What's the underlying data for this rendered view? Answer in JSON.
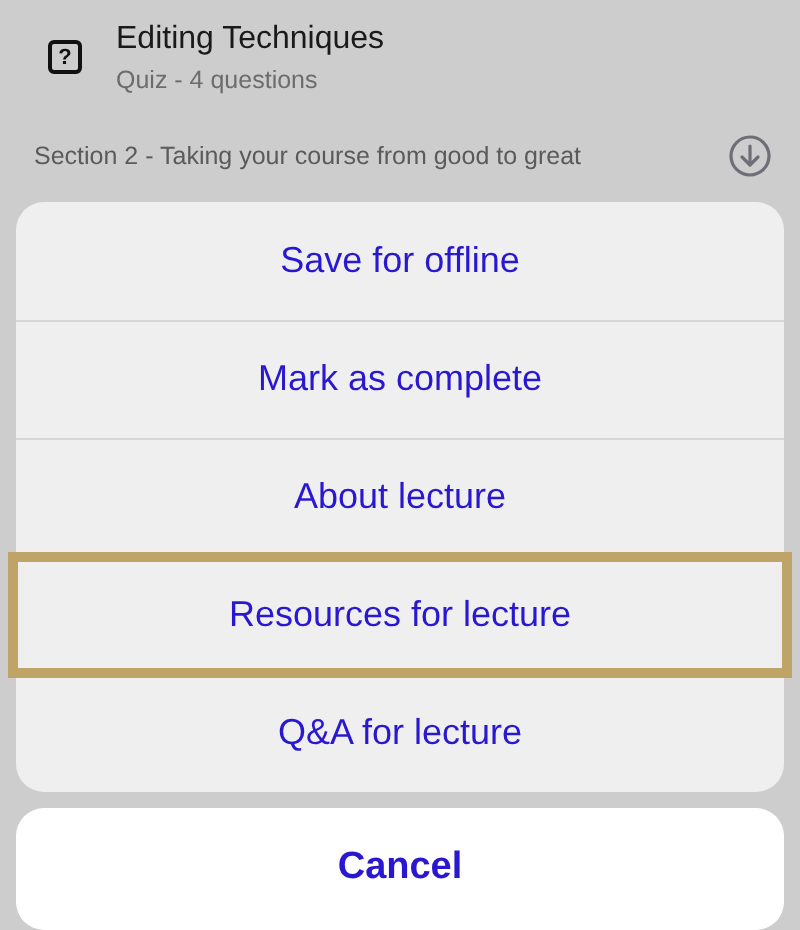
{
  "lesson": {
    "title": "Editing Techniques",
    "subtitle": "Quiz - 4 questions",
    "icon": "?"
  },
  "section": {
    "title": "Section 2 - Taking your course from good to great"
  },
  "action_sheet": {
    "actions": [
      {
        "label": "Save for offline",
        "selected": false
      },
      {
        "label": "Mark as complete",
        "selected": false
      },
      {
        "label": "About lecture",
        "selected": false
      },
      {
        "label": "Resources for lecture",
        "selected": true
      },
      {
        "label": "Q&A for lecture",
        "selected": false
      }
    ],
    "cancel": "Cancel"
  }
}
